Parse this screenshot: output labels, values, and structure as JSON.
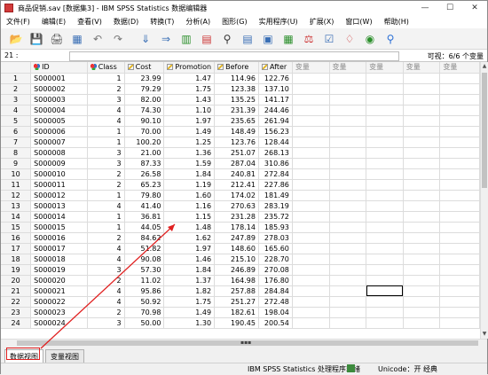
{
  "window": {
    "title": "商品促销.sav [数据集3] - IBM SPSS Statistics 数据编辑器",
    "controls": [
      "—",
      "☐",
      "✕"
    ]
  },
  "menu": [
    "文件(F)",
    "编辑(E)",
    "查看(V)",
    "数据(D)",
    "转换(T)",
    "分析(A)",
    "图形(G)",
    "实用程序(U)",
    "扩展(X)",
    "窗口(W)",
    "帮助(H)"
  ],
  "toolbar": {
    "icons": [
      "open-folder-icon",
      "save-icon",
      "print-icon",
      "recall-dialog-icon",
      "undo-icon",
      "redo-icon",
      "goto-case-icon",
      "goto-variable-icon",
      "variables-icon",
      "run-descriptive-icon",
      "find-icon",
      "insert-cases-icon",
      "insert-variable-icon",
      "split-file-icon",
      "weight-cases-icon",
      "select-cases-icon",
      "value-labels-icon",
      "use-sets-icon",
      "search-icon"
    ]
  },
  "cellref": {
    "ref": "21 :",
    "visible": "可视：6/6 个变量"
  },
  "columns": [
    {
      "name": "ID",
      "icon": "nominal-icon"
    },
    {
      "name": "Class",
      "icon": "nominal-icon"
    },
    {
      "name": "Cost",
      "icon": "scale-icon"
    },
    {
      "name": "Promotion",
      "icon": "scale-icon"
    },
    {
      "name": "Before",
      "icon": "scale-icon"
    },
    {
      "name": "After",
      "icon": "scale-icon"
    }
  ],
  "empty_column_label": "变量",
  "empty_column_count": 5,
  "rows": [
    [
      "S000001",
      "1",
      "23.99",
      "1.47",
      "114.96",
      "122.76"
    ],
    [
      "S000002",
      "2",
      "79.29",
      "1.75",
      "123.38",
      "137.10"
    ],
    [
      "S000003",
      "3",
      "82.00",
      "1.43",
      "135.25",
      "141.17"
    ],
    [
      "S000004",
      "4",
      "74.30",
      "1.10",
      "231.39",
      "244.46"
    ],
    [
      "S000005",
      "4",
      "90.10",
      "1.97",
      "235.65",
      "261.94"
    ],
    [
      "S000006",
      "1",
      "70.00",
      "1.49",
      "148.49",
      "156.23"
    ],
    [
      "S000007",
      "1",
      "100.20",
      "1.25",
      "123.76",
      "128.44"
    ],
    [
      "S000008",
      "3",
      "21.00",
      "1.36",
      "251.07",
      "268.13"
    ],
    [
      "S000009",
      "3",
      "87.33",
      "1.59",
      "287.04",
      "310.86"
    ],
    [
      "S000010",
      "2",
      "26.58",
      "1.84",
      "240.81",
      "272.84"
    ],
    [
      "S000011",
      "2",
      "65.23",
      "1.19",
      "212.41",
      "227.86"
    ],
    [
      "S000012",
      "1",
      "79.80",
      "1.60",
      "174.02",
      "181.49"
    ],
    [
      "S000013",
      "4",
      "41.40",
      "1.16",
      "270.63",
      "283.19"
    ],
    [
      "S000014",
      "1",
      "36.81",
      "1.15",
      "231.28",
      "235.72"
    ],
    [
      "S000015",
      "1",
      "44.05",
      "1.48",
      "178.14",
      "185.93"
    ],
    [
      "S000016",
      "2",
      "84.62",
      "1.62",
      "247.89",
      "278.03"
    ],
    [
      "S000017",
      "4",
      "51.82",
      "1.97",
      "148.60",
      "165.60"
    ],
    [
      "S000018",
      "4",
      "90.08",
      "1.46",
      "215.10",
      "228.70"
    ],
    [
      "S000019",
      "3",
      "57.30",
      "1.84",
      "246.89",
      "270.08"
    ],
    [
      "S000020",
      "2",
      "11.02",
      "1.37",
      "164.98",
      "176.80"
    ],
    [
      "S000021",
      "4",
      "95.86",
      "1.82",
      "257.88",
      "284.84"
    ],
    [
      "S000022",
      "4",
      "50.92",
      "1.75",
      "251.27",
      "272.48"
    ],
    [
      "S000023",
      "2",
      "70.98",
      "1.49",
      "182.61",
      "198.04"
    ],
    [
      "S000024",
      "3",
      "50.00",
      "1.30",
      "190.45",
      "200.54"
    ]
  ],
  "tabs": {
    "data_view": "数据视图",
    "variable_view": "变量视图"
  },
  "status": {
    "processor": "IBM SPSS Statistics 处理程序就绪",
    "unicode": "Unicode：开  经典"
  },
  "colors": {
    "annotation": "#e02020"
  }
}
